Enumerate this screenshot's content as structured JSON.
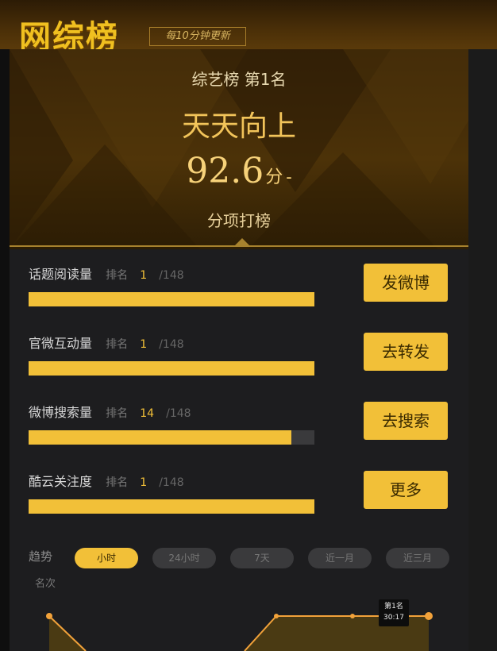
{
  "header": {
    "logo": "网综榜",
    "tagline": "每10分钟更新"
  },
  "hero": {
    "subtitle": "综艺榜  第1名",
    "title": "天天向上",
    "score": "92.6",
    "score_unit": "分",
    "score_trend": "-",
    "tab": "分项打榜"
  },
  "metrics": [
    {
      "label": "话题阅读量",
      "rank_word": "排名",
      "rank": "1",
      "total": "/148",
      "fill": 1.0,
      "action": "发微博"
    },
    {
      "label": "官微互动量",
      "rank_word": "排名",
      "rank": "1",
      "total": "/148",
      "fill": 1.0,
      "action": "去转发"
    },
    {
      "label": "微博搜索量",
      "rank_word": "排名",
      "rank": "14",
      "total": "/148",
      "fill": 0.92,
      "action": "去搜索"
    },
    {
      "label": "酷云关注度",
      "rank_word": "排名",
      "rank": "1",
      "total": "/148",
      "fill": 1.0,
      "action": "更多"
    }
  ],
  "trend": {
    "label": "趋势",
    "axis_label": "名次",
    "ranges": [
      "小时",
      "24小时",
      "7天",
      "近一月",
      "近三月"
    ],
    "active_index": 0,
    "tooltip_line1": "第1名",
    "tooltip_line2": "30:17"
  },
  "colors": {
    "accent": "#f2c038",
    "panel": "#1d1d1f"
  }
}
